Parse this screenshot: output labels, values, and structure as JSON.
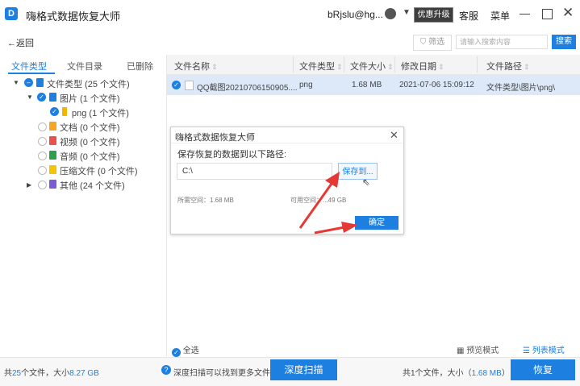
{
  "titlebar": {
    "app_title": "嗨格式数据恢复大师",
    "user_name": "bRjslu@hg...",
    "upgrade_label": "优惠升级",
    "service_label": "客服",
    "menu_label": "菜单"
  },
  "toolbar": {
    "back_label": "←返回",
    "filter_label": "筛选",
    "search_placeholder": "请输入搜索内容",
    "search_button": "搜索"
  },
  "left_tabs": [
    "文件类型",
    "文件目录",
    "已删除"
  ],
  "tree": {
    "root": "文件类型 (25 个文件)",
    "images": "图片 (1 个文件)",
    "png": "png (1 个文件)",
    "docs": "文档 (0 个文件)",
    "video": "视频 (0 个文件)",
    "audio": "音频 (0 个文件)",
    "archive": "压缩文件 (0 个文件)",
    "other": "其他 (24 个文件)"
  },
  "table": {
    "columns": [
      "文件名称",
      "文件类型",
      "文件大小",
      "修改日期",
      "文件路径"
    ],
    "rows": [
      {
        "name": "QQ截图20210706150905....",
        "type": "png",
        "size": "1.68 MB",
        "date": "2021-07-06 15:09:12",
        "path": "文件类型\\图片\\png\\"
      }
    ]
  },
  "dialog": {
    "title": "嗨格式数据恢复大师",
    "label": "保存恢复的数据到以下路径:",
    "path_value": "C:\\",
    "save_to": "保存到...",
    "required_space": "所需空间：1.68 MB",
    "free_space": "可用空间：...49 GB",
    "ok": "确定"
  },
  "bottom": {
    "select_all": "全选",
    "preview_mode": "预览模式",
    "list_mode": "列表模式"
  },
  "status": {
    "total_prefix": "共",
    "total_count": "25",
    "total_mid": "个文件，大小",
    "total_size": "8.27 GB",
    "hint": "深度扫描可以找到更多文件",
    "deep_scan": "深度扫描",
    "selected_prefix": "共1个文件，大小（",
    "selected_size": "1.68 MB",
    "selected_suffix": "）",
    "recover": "恢复"
  },
  "colors": {
    "accent": "#1d7fe0",
    "annotation_arrow": "#e53935"
  }
}
